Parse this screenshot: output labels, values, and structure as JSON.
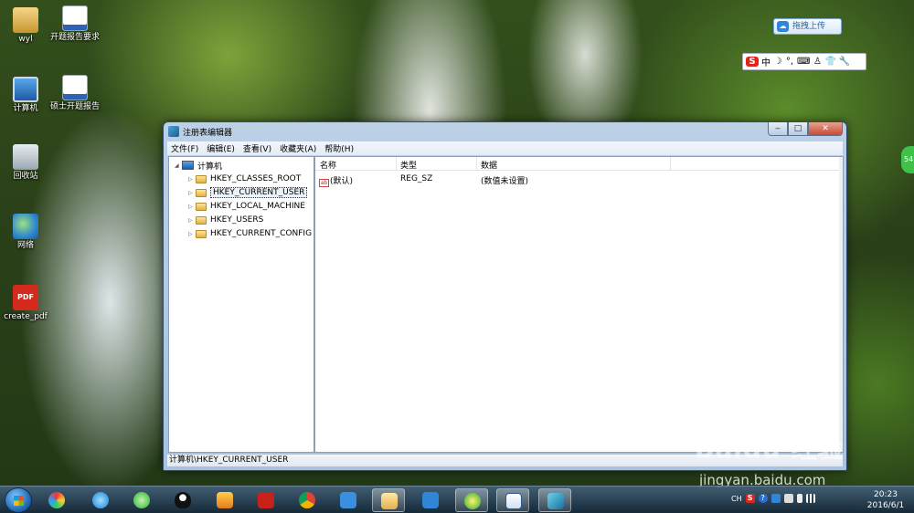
{
  "desktop": {
    "icons": [
      {
        "label": "wyl"
      },
      {
        "label": "开题报告要求"
      },
      {
        "label": "计算机"
      },
      {
        "label": "硕士开题报告"
      },
      {
        "label": "回收站"
      },
      {
        "label": "网络"
      },
      {
        "label": "create_pdf"
      }
    ]
  },
  "widgets": {
    "upload_label": "拖拽上传",
    "ime": {
      "s": "S",
      "lang": "中",
      "moon": "☽",
      "dot": "°,",
      "kbd": "⌨",
      "person": "♙",
      "shirt": "👕",
      "tool": "🔧"
    },
    "edge_badge": "54"
  },
  "window": {
    "title": "注册表编辑器",
    "buttons": {
      "min": "‒",
      "max": "□",
      "close": "✕"
    },
    "menu": [
      "文件(F)",
      "编辑(E)",
      "查看(V)",
      "收藏夹(A)",
      "帮助(H)"
    ],
    "tree": {
      "root": "计算机",
      "children": [
        "HKEY_CLASSES_ROOT",
        "HKEY_CURRENT_USER",
        "HKEY_LOCAL_MACHINE",
        "HKEY_USERS",
        "HKEY_CURRENT_CONFIG"
      ],
      "selected": "HKEY_CURRENT_USER"
    },
    "list": {
      "columns": [
        "名称",
        "类型",
        "数据"
      ],
      "rows": [
        {
          "name": "(默认)",
          "type": "REG_SZ",
          "data": "(数值未设置)",
          "icon": "ab"
        }
      ]
    },
    "status": "计算机\\HKEY_CURRENT_USER"
  },
  "watermark": {
    "logo": "Baidu 经验",
    "url": "jingyan.baidu.com"
  },
  "taskbar": {
    "apps": [
      "start",
      "color-app",
      "ie",
      "360-browser",
      "qq",
      "gift-app",
      "wps",
      "chrome",
      "rss",
      "explorer",
      "baidu-netdisk",
      "360-safe",
      "word",
      "regedit"
    ],
    "active": "regedit",
    "tray": {
      "lang": "CH",
      "s": "S",
      "help": "?"
    },
    "time": "20:23",
    "date": "2016/6/1"
  },
  "colors": {
    "accent": "#2b63a9",
    "selection": "#eaf2fb",
    "window_frame": "#a9c2dd"
  }
}
